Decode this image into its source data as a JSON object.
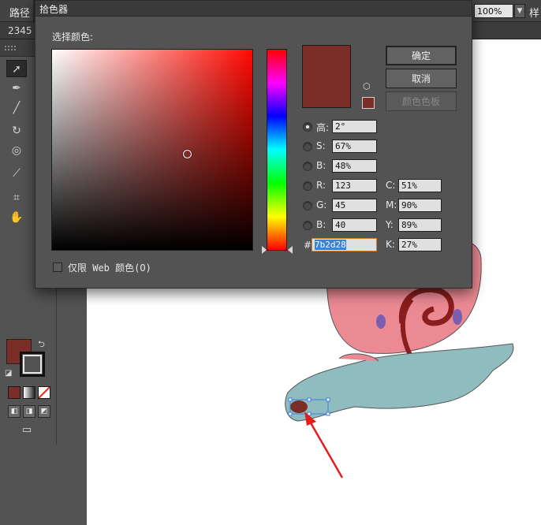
{
  "app": {
    "path_label": "路径",
    "style_label": "样",
    "zoom_value": "100%",
    "ruler_value": "2345"
  },
  "dialog": {
    "title": "拾色器",
    "heading": "选择颜色:",
    "buttons": {
      "ok": "确定",
      "cancel": "取消",
      "swatches": "颜色色板"
    },
    "hsb": [
      {
        "label": "高:",
        "value": "2°",
        "selected": true
      },
      {
        "label": "S:",
        "value": "67%",
        "selected": false
      },
      {
        "label": "B:",
        "value": "48%",
        "selected": false
      }
    ],
    "rgb": [
      {
        "label": "R:",
        "value": "123"
      },
      {
        "label": "G:",
        "value": "45"
      },
      {
        "label": "B:",
        "value": "40"
      }
    ],
    "cmyk": [
      {
        "label": "C:",
        "value": "51%"
      },
      {
        "label": "M:",
        "value": "90%"
      },
      {
        "label": "Y:",
        "value": "89%"
      },
      {
        "label": "K:",
        "value": "27%"
      }
    ],
    "hex_prefix": "#",
    "hex_value": "7b2d28",
    "web_only_label": "仅限 Web 颜色(O)",
    "web_only_checked": false
  },
  "colors": {
    "selected": "#7b2d28",
    "hue_pure": "#ff0a00",
    "stroke": "#222222"
  },
  "tools": [
    {
      "name": "selection-tool",
      "glyph": "➚",
      "active": true
    },
    {
      "name": "magic-wand-tool",
      "glyph": "✶",
      "active": false
    },
    {
      "name": "pen-tool",
      "glyph": "✒",
      "active": false
    },
    {
      "name": "curvature-tool",
      "glyph": "⌒",
      "active": false
    },
    {
      "name": "paintbrush-tool",
      "glyph": "╱",
      "active": false
    },
    {
      "name": "blob-brush-tool",
      "glyph": "✎",
      "active": false
    },
    {
      "name": "rotate-tool",
      "glyph": "↻",
      "active": false
    },
    {
      "name": "warp-tool",
      "glyph": "≋",
      "active": false
    },
    {
      "name": "shape-builder-tool",
      "glyph": "◎",
      "active": false
    },
    {
      "name": "perspective-grid-tool",
      "glyph": "▦",
      "active": false
    },
    {
      "name": "eyedropper-tool",
      "glyph": "⟋",
      "active": false
    },
    {
      "name": "symbol-sprayer-tool",
      "glyph": "⊡",
      "active": false
    },
    {
      "name": "artboard-tool",
      "glyph": "⌗",
      "active": false
    },
    {
      "name": "slice-tool",
      "glyph": "⟋",
      "active": false
    },
    {
      "name": "hand-tool",
      "glyph": "✋",
      "active": false
    },
    {
      "name": "zoom-tool",
      "glyph": "⚲",
      "active": false
    }
  ]
}
